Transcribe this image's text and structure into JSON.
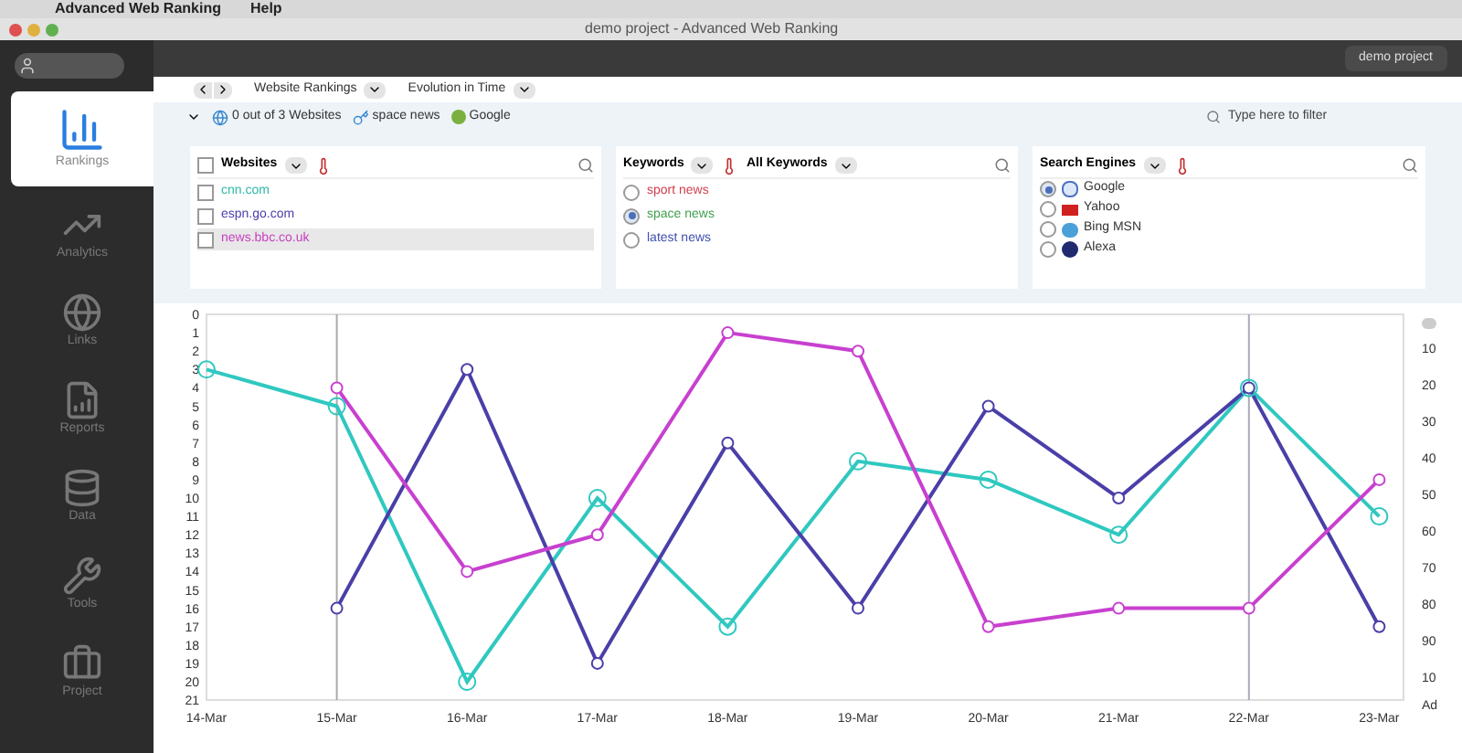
{
  "menubar": {
    "items": [
      "Advanced Web Ranking",
      "Help"
    ]
  },
  "window": {
    "title": "demo project - Advanced Web Ranking"
  },
  "toolbar": {
    "project_button": "demo project"
  },
  "sidebar": {
    "items": [
      {
        "label": "Rankings",
        "kind": "bars",
        "selected": true
      },
      {
        "label": "Analytics",
        "kind": "trend",
        "selected": false
      },
      {
        "label": "Links",
        "kind": "globe",
        "selected": false
      },
      {
        "label": "Reports",
        "kind": "report",
        "selected": false
      },
      {
        "label": "Data",
        "kind": "data",
        "selected": false
      },
      {
        "label": "Tools",
        "kind": "tools",
        "selected": false
      },
      {
        "label": "Project",
        "kind": "project",
        "selected": false
      }
    ]
  },
  "breadcrumb": [
    "Website Rankings",
    "Evolution in Time"
  ],
  "filter_bar": {
    "chips": [
      {
        "kind": "globe",
        "label": "0 out of 3 Websites"
      },
      {
        "kind": "key",
        "label": "space news"
      },
      {
        "kind": "engine",
        "label": "Google"
      }
    ],
    "search": {
      "placeholder": "Type here to filter"
    }
  },
  "websites": {
    "title": "Websites",
    "checked": false,
    "items": [
      {
        "label": "cnn.com",
        "color": "#2fb8a8",
        "checked": false,
        "selected": false
      },
      {
        "label": "espn.go.com",
        "color": "#4a3fa8",
        "checked": false,
        "selected": false
      },
      {
        "label": "news.bbc.co.uk",
        "color": "#c840c0",
        "checked": false,
        "selected": true
      }
    ]
  },
  "keywords": {
    "title": "Keywords",
    "group": "All Keywords",
    "items": [
      {
        "label": "sport news",
        "color": "#d04050",
        "selected": false
      },
      {
        "label": "space news",
        "color": "#40a050",
        "selected": true
      },
      {
        "label": "latest news",
        "color": "#4050b0",
        "selected": false
      }
    ]
  },
  "search_engines": {
    "title": "Search Engines",
    "items": [
      {
        "label": "Google",
        "kind": "square",
        "selected": true
      },
      {
        "label": "Yahoo",
        "kind": "flag",
        "selected": false
      },
      {
        "label": "Bing MSN",
        "kind": "cloud",
        "selected": false
      },
      {
        "label": "Alexa",
        "kind": "circle",
        "selected": false
      }
    ]
  },
  "chart": {
    "chart_data": {
      "type": "line",
      "categories": [
        "14-Mar",
        "15-Mar",
        "16-Mar",
        "17-Mar",
        "18-Mar",
        "19-Mar",
        "20-Mar",
        "21-Mar",
        "22-Mar",
        "23-Mar"
      ],
      "ylim": [
        21,
        0
      ],
      "ref_lines": [
        {
          "axis": "x",
          "value": "15-Mar",
          "color": "#aaaaaa"
        },
        {
          "axis": "x",
          "value": "22-Mar",
          "color": "#aaaabb"
        }
      ],
      "yticks": [
        0,
        1,
        2,
        3,
        4,
        5,
        6,
        7,
        8,
        9,
        10,
        11,
        12,
        13,
        14,
        15,
        16,
        17,
        18,
        19,
        20,
        21
      ],
      "series": [
        {
          "color": "#2fc8c0",
          "marker": "circle",
          "values": [
            3,
            5,
            20,
            10,
            17,
            8,
            9,
            12,
            4,
            11
          ]
        },
        {
          "color": "#4a3fa8",
          "marker": "circle",
          "values": [
            null,
            16,
            3,
            19,
            7,
            16,
            5,
            10,
            4,
            17
          ]
        },
        {
          "color": "#c840d0",
          "marker": "circle",
          "values": [
            null,
            4,
            14,
            12,
            1,
            2,
            17,
            16,
            16,
            9
          ]
        }
      ]
    },
    "right_axis": [
      "10",
      "20",
      "30",
      "40",
      "50",
      "60",
      "70",
      "80",
      "90",
      "10"
    ],
    "right_axis_label": "Ad"
  }
}
